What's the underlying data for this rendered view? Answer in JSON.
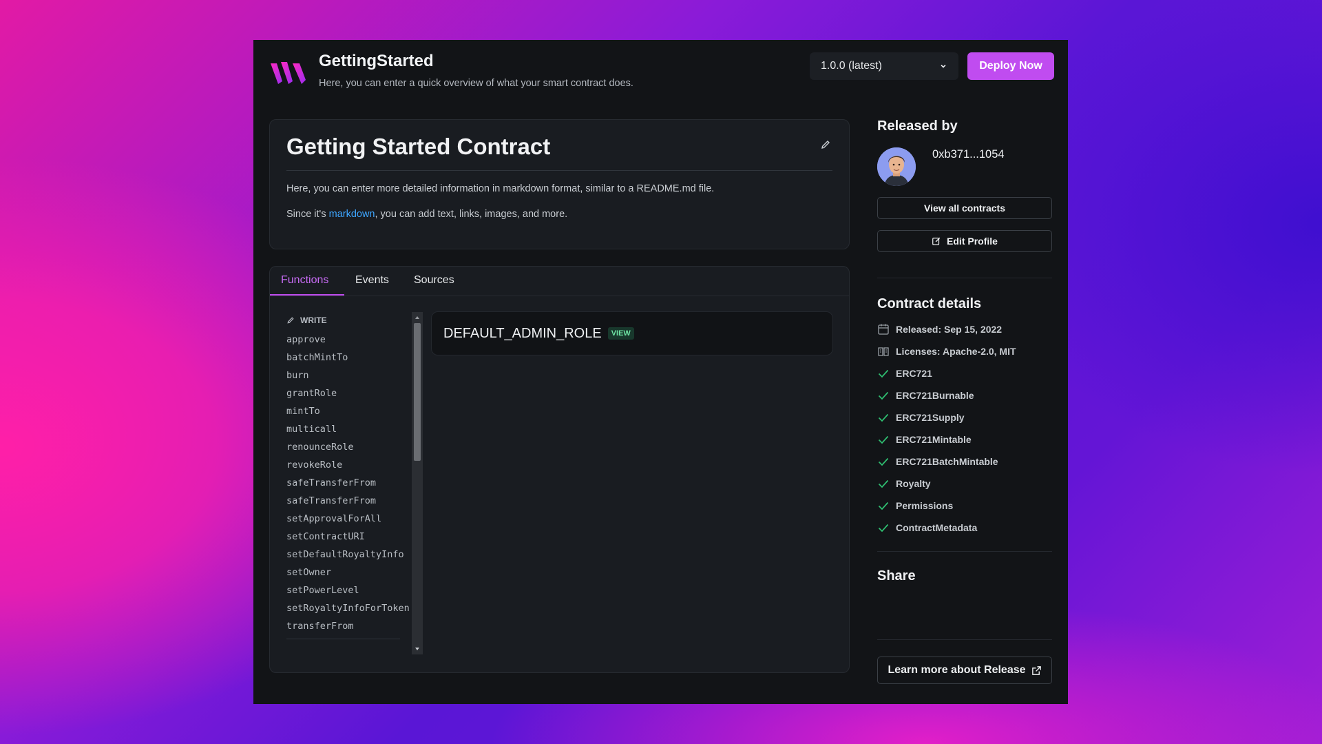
{
  "header": {
    "title": "GettingStarted",
    "subtitle": "Here, you can enter a quick overview of what your smart contract does.",
    "version": "1.0.0 (latest)",
    "deploy_label": "Deploy Now"
  },
  "overview": {
    "title": "Getting Started Contract",
    "paragraph1": "Here, you can enter more detailed information in markdown format, similar to a README.md file.",
    "paragraph2_before": "Since it's ",
    "paragraph2_link": "markdown",
    "paragraph2_after": ", you can add text, links, images, and more."
  },
  "tabs": [
    "Functions",
    "Events",
    "Sources"
  ],
  "functions": {
    "section_label": "WRITE",
    "items": [
      "approve",
      "batchMintTo",
      "burn",
      "grantRole",
      "mintTo",
      "multicall",
      "renounceRole",
      "revokeRole",
      "safeTransferFrom",
      "safeTransferFrom",
      "setApprovalForAll",
      "setContractURI",
      "setDefaultRoyaltyInfo",
      "setOwner",
      "setPowerLevel",
      "setRoyaltyInfoForToken",
      "transferFrom"
    ],
    "selected_name": "DEFAULT_ADMIN_ROLE",
    "selected_badge": "VIEW"
  },
  "sidebar": {
    "released_by_heading": "Released by",
    "address": "0xb371...1054",
    "view_all_label": "View all contracts",
    "edit_profile_label": "Edit Profile",
    "details_heading": "Contract details",
    "released": "Released: Sep 15, 2022",
    "licenses": "Licenses: Apache-2.0, MIT",
    "extensions": [
      "ERC721",
      "ERC721Burnable",
      "ERC721Supply",
      "ERC721Mintable",
      "ERC721BatchMintable",
      "Royalty",
      "Permissions",
      "ContractMetadata"
    ],
    "share_heading": "Share",
    "learn_more_label": "Learn more about Release"
  },
  "colors": {
    "accent": "#c04cf0",
    "link": "#3ea6ff",
    "check": "#2fbf71",
    "panel": "#121417"
  }
}
